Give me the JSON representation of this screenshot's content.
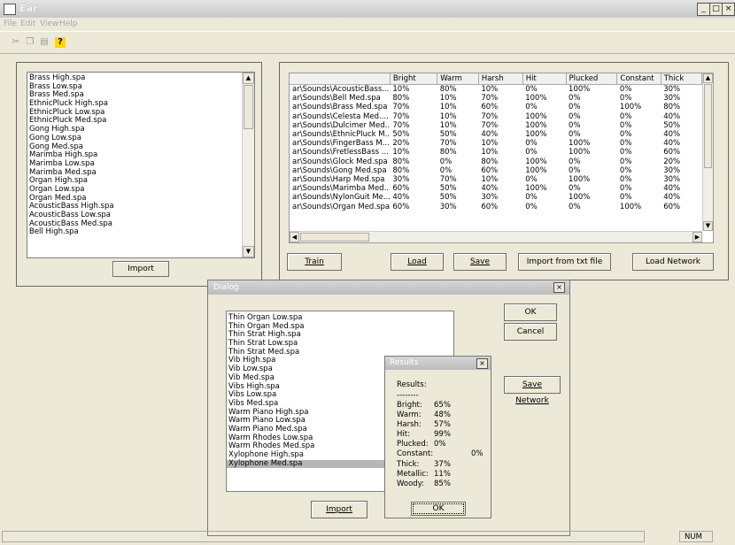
{
  "window": {
    "title": "Ear",
    "min": "_",
    "max": "□",
    "close": "×"
  },
  "menu": [
    "File",
    "Edit",
    "View",
    "Help"
  ],
  "toolbar": {
    "icons": [
      "cut-icon",
      "copy-icon",
      "paste-icon",
      "help-icon"
    ],
    "help_glyph": "?"
  },
  "left_panel": {
    "files": [
      "Brass High.spa",
      "Brass Low.spa",
      "Brass Med.spa",
      "EthnicPluck High.spa",
      "EthnicPluck Low.spa",
      "EthnicPluck Med.spa",
      "Gong High.spa",
      "Gong Low.spa",
      "Gong Med.spa",
      "Marimba High.spa",
      "Marimba Low.spa",
      "Marimba Med.spa",
      "Organ High.spa",
      "Organ Low.spa",
      "Organ Med.spa",
      "AcousticBass High.spa",
      "AcousticBass Low.spa",
      "AcousticBass Med.spa",
      "Bell High.spa"
    ],
    "import_label": "Import"
  },
  "grid": {
    "columns": [
      "",
      "Bright",
      "Warm",
      "Harsh",
      "Hit",
      "Plucked",
      "Constant",
      "Thick"
    ],
    "rows": [
      [
        "ar\\Sounds\\AcousticBass...",
        "10%",
        "80%",
        "10%",
        "0%",
        "100%",
        "0%",
        "30%"
      ],
      [
        "ar\\Sounds\\Bell Med.spa",
        "80%",
        "10%",
        "70%",
        "100%",
        "0%",
        "0%",
        "30%"
      ],
      [
        "ar\\Sounds\\Brass Med.spa",
        "70%",
        "10%",
        "60%",
        "0%",
        "0%",
        "100%",
        "80%"
      ],
      [
        "ar\\Sounds\\Celesta Med....",
        "70%",
        "10%",
        "70%",
        "100%",
        "0%",
        "0%",
        "40%"
      ],
      [
        "ar\\Sounds\\Dulcimer Med...",
        "70%",
        "10%",
        "70%",
        "100%",
        "0%",
        "0%",
        "50%"
      ],
      [
        "ar\\Sounds\\EthnicPluck M...",
        "50%",
        "50%",
        "40%",
        "100%",
        "0%",
        "0%",
        "40%"
      ],
      [
        "ar\\Sounds\\FingerBass M...",
        "20%",
        "70%",
        "10%",
        "0%",
        "100%",
        "0%",
        "40%"
      ],
      [
        "ar\\Sounds\\FretlessBass ...",
        "10%",
        "80%",
        "10%",
        "0%",
        "100%",
        "0%",
        "60%"
      ],
      [
        "ar\\Sounds\\Glock Med.spa",
        "80%",
        "0%",
        "80%",
        "100%",
        "0%",
        "0%",
        "20%"
      ],
      [
        "ar\\Sounds\\Gong Med.spa",
        "80%",
        "0%",
        "60%",
        "100%",
        "0%",
        "0%",
        "30%"
      ],
      [
        "ar\\Sounds\\Harp Med.spa",
        "30%",
        "70%",
        "10%",
        "0%",
        "100%",
        "0%",
        "30%"
      ],
      [
        "ar\\Sounds\\Marimba Med...",
        "60%",
        "50%",
        "40%",
        "100%",
        "0%",
        "0%",
        "40%"
      ],
      [
        "ar\\Sounds\\NylonGuit Me...",
        "40%",
        "50%",
        "30%",
        "0%",
        "100%",
        "0%",
        "40%"
      ],
      [
        "ar\\Sounds\\Organ Med.spa",
        "60%",
        "30%",
        "60%",
        "0%",
        "0%",
        "100%",
        "60%"
      ]
    ]
  },
  "buttons": {
    "train": "Train",
    "load": "Load",
    "save": "Save",
    "import_txt": "Import from txt file",
    "load_network": "Load Network"
  },
  "dialog": {
    "title": "Dialog",
    "close": "×",
    "files": [
      "Thin Organ Low.spa",
      "Thin Organ Med.spa",
      "Thin Strat High.spa",
      "Thin Strat Low.spa",
      "Thin Strat Med.spa",
      "Vib High.spa",
      "Vib Low.spa",
      "Vib Med.spa",
      "Vibs High.spa",
      "Vibs Low.spa",
      "Vibs Med.spa",
      "Warm Piano High.spa",
      "Warm Piano Low.spa",
      "Warm Piano Med.spa",
      "Warm Rhodes Low.spa",
      "Warm Rhodes Med.spa",
      "Xylophone High.spa",
      "Xylophone Med.spa"
    ],
    "selected_index": 17,
    "ok": "OK",
    "cancel": "Cancel",
    "save_network": "Save Network",
    "import_label": "Import"
  },
  "results": {
    "title": "Results",
    "close": "×",
    "heading": "Results:",
    "separator": "--------",
    "lines": [
      {
        "label": "Bright:",
        "value": "65%"
      },
      {
        "label": "Warm:",
        "value": "48%"
      },
      {
        "label": "Harsh:",
        "value": "57%"
      },
      {
        "label": "Hit:",
        "value": "99%"
      },
      {
        "label": "Plucked:",
        "value": "0%"
      },
      {
        "label": "Constant:",
        "value": "0%"
      },
      {
        "label": "Thick:",
        "value": "37%"
      },
      {
        "label": "Metallic:",
        "value": "11%"
      },
      {
        "label": "Woody:",
        "value": "85%"
      }
    ],
    "ok": "OK"
  },
  "status": {
    "num": "NUM"
  }
}
